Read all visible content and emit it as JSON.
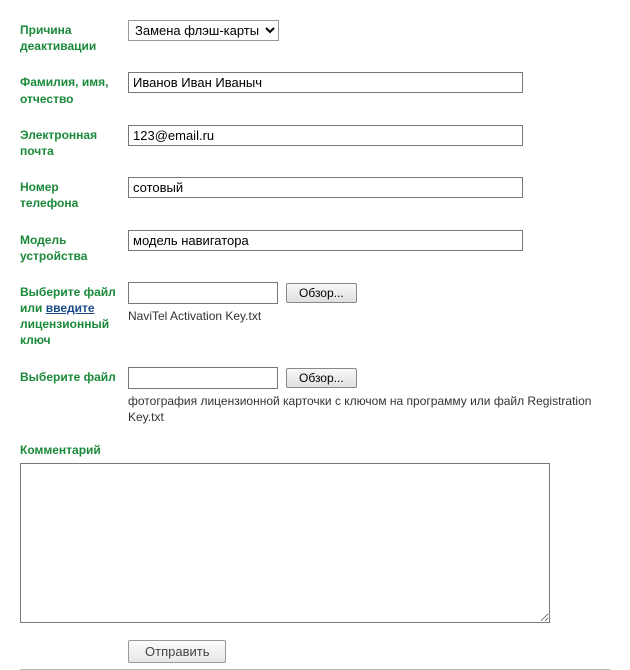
{
  "reason": {
    "label": "Причина деактивации",
    "value": "Замена флэш-карты"
  },
  "name": {
    "label": "Фамилия, имя, отчество",
    "value": "Иванов Иван Иваныч"
  },
  "email": {
    "label": "Электронная почта",
    "value": "123@email.ru"
  },
  "phone": {
    "label": "Номер телефона",
    "value": "сотовый"
  },
  "device": {
    "label": "Модель устройства",
    "value": "модель навигатора"
  },
  "file1": {
    "label_part1": "Выберите файл",
    "label_or": "или ",
    "label_link": "введите",
    "label_part2": " лицензионный ключ",
    "browse": "Обзор...",
    "hint": "NaviTel Activation Key.txt"
  },
  "file2": {
    "label": "Выберите файл",
    "browse": "Обзор...",
    "hint": "фотография лицензионной карточки с ключом на программу или файл Registration Key.txt"
  },
  "comment": {
    "label": "Комментарий",
    "value": ""
  },
  "submit": {
    "label": "Отправить"
  }
}
